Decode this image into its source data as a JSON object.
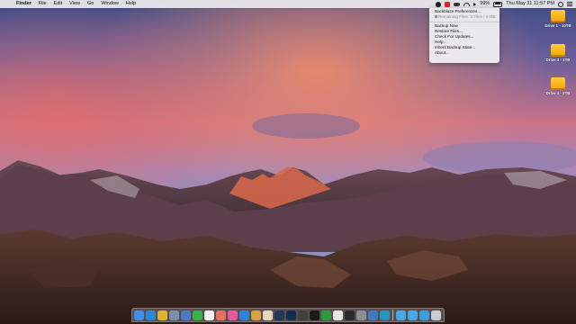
{
  "menubar": {
    "apple_glyph": "",
    "items": [
      "Finder",
      "File",
      "Edit",
      "View",
      "Go",
      "Window",
      "Help"
    ],
    "battery_percent": "99%",
    "clock": "Thu May 31  11:57 PM",
    "status_icons": [
      "flame-icon",
      "backblaze-icon",
      "cloud-icon",
      "wifi-icon",
      "volume-icon"
    ],
    "right_icons": [
      "search-icon",
      "notification-list-icon"
    ]
  },
  "dropdown": {
    "items": [
      {
        "label": "Backblaze Preferences...",
        "disabled": false
      },
      {
        "label": "Remaining Files: 3 Files / 0 MB",
        "disabled": true
      },
      {
        "separator": true
      },
      {
        "label": "Backup Now",
        "disabled": false
      },
      {
        "label": "Restore Files...",
        "disabled": false
      },
      {
        "label": "Check For Updates...",
        "disabled": false
      },
      {
        "label": "Help...",
        "disabled": false
      },
      {
        "label": "Inherit Backup State...",
        "disabled": false
      },
      {
        "label": "About...",
        "disabled": false
      }
    ]
  },
  "desktop": {
    "drives": [
      {
        "label": "Drive 1 - 10TB"
      },
      {
        "label": "Drive 3 - 1TB"
      },
      {
        "label": "Drive 4 - 2TB"
      }
    ]
  },
  "dock": {
    "apps": [
      {
        "name": "finder-icon",
        "color": "#3f8fe8"
      },
      {
        "name": "safari-icon",
        "color": "#2a86d8"
      },
      {
        "name": "chrome-icon",
        "color": "#e2b030"
      },
      {
        "name": "preview-icon",
        "color": "#7a8fa8"
      },
      {
        "name": "migration-icon",
        "color": "#4a7bc4"
      },
      {
        "name": "messages-icon",
        "color": "#37b34a"
      },
      {
        "name": "calendar-icon",
        "color": "#f1f1f1"
      },
      {
        "name": "photos-icon",
        "color": "#e07060"
      },
      {
        "name": "itunes-icon",
        "color": "#e55a9a"
      },
      {
        "name": "app-store-icon",
        "color": "#2b82e2"
      },
      {
        "name": "stickies-icon",
        "color": "#d7a33a"
      },
      {
        "name": "photos-app-icon",
        "color": "#e5d6c0"
      },
      {
        "name": "lightroom-icon",
        "color": "#1e3a58"
      },
      {
        "name": "photoshop-icon",
        "color": "#0d2f52"
      },
      {
        "name": "final-cut-icon",
        "color": "#404040"
      },
      {
        "name": "quicktime-icon",
        "color": "#1a1a1a"
      },
      {
        "name": "numbers-icon",
        "color": "#2c9a3c"
      },
      {
        "name": "textedit-icon",
        "color": "#e4e4e4"
      },
      {
        "name": "terminal-icon",
        "color": "#2a2a2a"
      },
      {
        "name": "system-prefs-icon",
        "color": "#8a8f96"
      },
      {
        "name": "time-machine-icon",
        "color": "#3b7bbf"
      },
      {
        "name": "backblaze-dock-icon",
        "color": "#2596be"
      }
    ],
    "folders": [
      {
        "name": "applications-folder-icon",
        "color": "#4aa8e8"
      },
      {
        "name": "documents-folder-icon",
        "color": "#4aa8e8"
      },
      {
        "name": "downloads-folder-icon",
        "color": "#3d9de0"
      },
      {
        "name": "trash-icon",
        "color": "#c9ccd0"
      }
    ]
  }
}
